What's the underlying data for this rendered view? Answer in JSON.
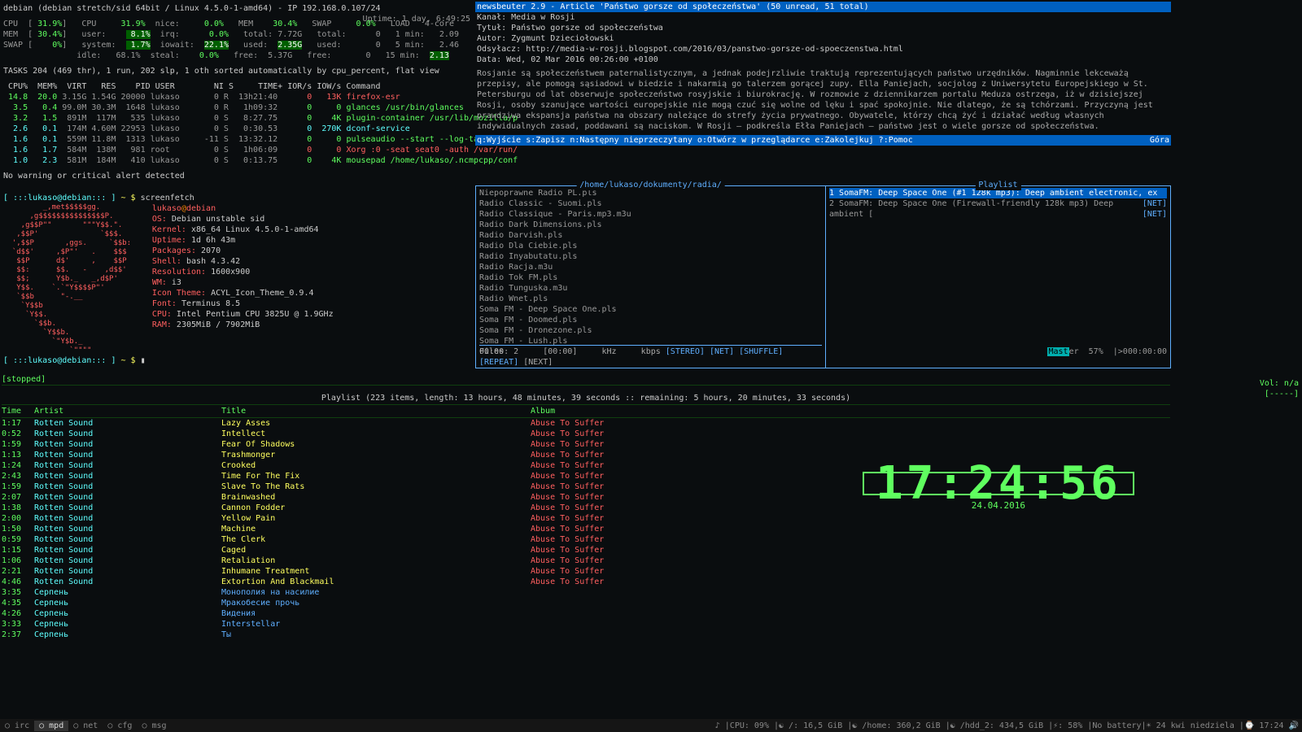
{
  "glances": {
    "host": "debian (debian stretch/sid 64bit / Linux 4.5.0-1-amd64) - IP 192.168.0.107/24",
    "uptime": "Uptime: 1 day, 6:49:25",
    "stats": [
      "CPU  [ 31.9%]   CPU     31.9%  nice:     0.0%   MEM    30.4%   SWAP     0.0%   LOAD   4-core",
      "MEM  [ 30.4%]   user:    8.1%  irq:      0.0%   total: 7.72G   total:      0   1 min:   2.09",
      "SWAP [    0%]   system:  1.7%  iowait:  22.1%   used:  2.35G   used:       0   5 min:   2.46",
      "               idle:   68.1%  steal:    0.0%   free:  5.37G   free:       0   15 min:  2.13"
    ],
    "tasks": "TASKS 204 (469 thr), 1 run, 202 slp, 1 oth sorted automatically by cpu_percent, flat view",
    "phead": " CPU%  MEM%  VIRT   RES    PID USER        NI S     TIME+ IOR/s IOW/s Command",
    "procs": [
      " 14.8  20.0 3.15G 1.54G 20000 lukaso       0 R  13h21:40      0   13K firefox-esr",
      "  3.5   0.4 99.0M 30.3M  1648 lukaso       0 R   1h09:32      0     0 glances /usr/bin/glances",
      "  3.2   1.5  891M  117M   535 lukaso       0 S   8:27.75      0    4K plugin-container /usr/lib/mozilla/p",
      "  2.6   0.1  174M 4.60M 22953 lukaso       0 S   0:30.53      0  270K dconf-service",
      "  1.6   0.1  559M 11.8M  1313 lukaso     -11 S  13:32.12      0     0 pulseaudio --start --log-target=sys",
      "  1.6   1.7  584M  138M   981 root         0 S   1h06:09      0     0 Xorg :0 -seat seat0 -auth /var/run/",
      "  1.0   2.3  581M  184M   410 lukaso       0 S   0:13.75      0    4K mousepad /home/lukaso/.ncmpcpp/conf"
    ],
    "warn": "No warning or critical alert detected"
  },
  "term": {
    "prompt": "[ :::lukaso@debian::: ] ~ $ screenfetch",
    "logo": [
      "         _,met$$$$$gg.           ",
      "      ,g$$$$$$$$$$$$$$$P.        ",
      "    ,g$$P\"\"       \"\"\"Y$$.\".      ",
      "   ,$$P'              `$$$.      ",
      "  ',$$P       ,ggs.     `$$b:    ",
      "  `d$$'     ,$P\"'   .    $$$     ",
      "   $$P      d$'     ,    $$P     ",
      "   $$:      $$.   -    ,d$$'     ",
      "   $$;      Y$b._   _,d$P'       ",
      "   Y$$.    `.`\"Y$$$$P\"'          ",
      "   `$$b      \"-.__               ",
      "    `Y$$b                        ",
      "     `Y$$.                       ",
      "       `$$b.                     ",
      "         `Y$$b.                  ",
      "           `\"Y$b._               ",
      "               `\"\"\"\"             "
    ],
    "info": [
      [
        "",
        "lukaso@debian"
      ],
      [
        "OS:",
        " Debian unstable sid"
      ],
      [
        "Kernel:",
        " x86_64 Linux 4.5.0-1-amd64"
      ],
      [
        "Uptime:",
        " 1d 6h 43m"
      ],
      [
        "Packages:",
        " 2070"
      ],
      [
        "Shell:",
        " bash 4.3.42"
      ],
      [
        "Resolution:",
        " 1600x900"
      ],
      [
        "WM:",
        " i3"
      ],
      [
        "Icon Theme:",
        " ACYL_Icon_Theme_0.9.4"
      ],
      [
        "Font:",
        " Terminus 8.5"
      ],
      [
        "CPU:",
        " Intel Pentium CPU 3825U @ 1.9GHz"
      ],
      [
        "RAM:",
        " 2305MiB / 7902MiB"
      ]
    ],
    "prompt2": "[ :::lukaso@debian::: ] ~ $ "
  },
  "news": {
    "title": "newsbeuter 2.9 - Article 'Państwo gorsze od społeczeństwa' (50 unread, 51 total)",
    "meta": [
      "Kanał: Media w Rosji",
      "Tytuł: Państwo gorsze od społeczeństwa",
      "Autor: Zygmunt Dzieciołowski",
      "Odsyłacz: http://media-w-rosji.blogspot.com/2016/03/panstwo-gorsze-od-spoeczenstwa.html",
      "Data: Wed, 02 Mar 2016 00:26:00 +0100"
    ],
    "body": "Rosjanie są społeczeństwem paternalistycznym, a jednak podejrzliwie traktują reprezentujących państwo urzędników. Nagminnie lekceważą przepisy, ale pomogą sąsiadowi w biedzie i nakarmią go talerzem gorącej zupy. Ella Paniejach, socjolog z Uniwersytetu Europejskiego w St. Petersburgu od lat obserwuje społeczeństwo rosyjskie i biurokrację. W rozmowie z dziennikarzem portalu Meduza ostrzega, iż w dzisiejszej Rosji, osoby szanujące wartości europejskie nie mogą czuć się wolne od lęku i spać spokojnie. Nie dlatego, że są tchórzami. Przyczyną jest prawdziwa ekspansja państwa na obszary należące do strefy życia prywatnego. Obywatele, którzy chcą żyć i działać według własnych indywidualnych zasad, poddawani są naciskom. W Rosji – podkreśla Ełła Paniejach – państwo jest o wiele gorsze od społeczeństwa.",
    "help": "q:Wyjście s:Zapisz n:Następny nieprzeczytany o:Otwórz w przeglądarce e:Zakolejkuj ?:Pomoc",
    "top": "Góra"
  },
  "moc": {
    "leftTitle": "/home/lukaso/dokumenty/radia/",
    "files": [
      "Niepoprawne Radio PL.pls",
      "Radio Classic - Suomi.pls",
      "Radio Classique - Paris.mp3.m3u",
      "Radio Dark Dimensions.pls",
      "Radio Darvish.pls",
      "Radio Dla Ciebie.pls",
      "Radio Inyabutatu.pls",
      "Radio Racja.m3u",
      "Radio Tok FM.pls",
      "Radio Tunguska.m3u",
      "Radio Wnet.pls",
      "Soma FM - Deep Space One.pls",
      "Soma FM - Doomed.pls",
      "Soma FM - Dronezone.pls",
      "Soma FM - Lush.pls"
    ],
    "filesCount": "Files: 2",
    "rightTitle": "Playlist",
    "pl": [
      {
        "n": "1",
        "t": "SomaFM: Deep Space One (#1 128k mp3): Deep ambient electronic, ex",
        "net": "[NET]",
        "sel": true
      },
      {
        "n": "2",
        "t": "SomaFM: Deep Space One (Firewall-friendly 128k mp3) Deep ambient [",
        "net": "[NET]",
        "sel": false
      }
    ],
    "master": "Master  57%  |>000:00:00",
    "time": "[]\n00:00        [00:00]     kHz     kbps [STEREO] [NET] [SHUFFLE] [REPEAT] [NEXT]\n["
  },
  "player": {
    "stopped": "[stopped]",
    "vol": "Vol: n/a\n[-----]",
    "title": "Playlist (223 items, length: 13 hours, 48 minutes, 39 seconds :: remaining: 5 hours, 20 minutes, 33 seconds)",
    "head": [
      "Time",
      "Artist",
      "Title",
      "Album"
    ],
    "rows": [
      [
        "1:17",
        "Rotten Sound",
        "Lazy Asses",
        "Abuse To Suffer",
        "a"
      ],
      [
        "0:52",
        "Rotten Sound",
        "Intellect",
        "Abuse To Suffer",
        "a"
      ],
      [
        "1:59",
        "Rotten Sound",
        "Fear Of Shadows",
        "Abuse To Suffer",
        "a"
      ],
      [
        "1:13",
        "Rotten Sound",
        "Trashmonger",
        "Abuse To Suffer",
        "a"
      ],
      [
        "1:24",
        "Rotten Sound",
        "Crooked",
        "Abuse To Suffer",
        "a"
      ],
      [
        "2:43",
        "Rotten Sound",
        "Time For The Fix",
        "Abuse To Suffer",
        "a"
      ],
      [
        "1:59",
        "Rotten Sound",
        "Slave To The Rats",
        "Abuse To Suffer",
        "a"
      ],
      [
        "2:07",
        "Rotten Sound",
        "Brainwashed",
        "Abuse To Suffer",
        "a"
      ],
      [
        "1:38",
        "Rotten Sound",
        "Cannon Fodder",
        "Abuse To Suffer",
        "a"
      ],
      [
        "2:00",
        "Rotten Sound",
        "Yellow Pain",
        "Abuse To Suffer",
        "a"
      ],
      [
        "1:50",
        "Rotten Sound",
        "Machine",
        "Abuse To Suffer",
        "a"
      ],
      [
        "0:59",
        "Rotten Sound",
        "The Clerk",
        "Abuse To Suffer",
        "a"
      ],
      [
        "1:15",
        "Rotten Sound",
        "Caged",
        "Abuse To Suffer",
        "a"
      ],
      [
        "1:06",
        "Rotten Sound",
        "Retaliation",
        "Abuse To Suffer",
        "a"
      ],
      [
        "2:21",
        "Rotten Sound",
        "Inhumane Treatment",
        "Abuse To Suffer",
        "a"
      ],
      [
        "4:46",
        "Rotten Sound",
        "Extortion And Blackmail",
        "Abuse To Suffer",
        "a"
      ],
      [
        "3:35",
        "Серпень",
        "Монополия на насилие",
        "<empty>",
        "b"
      ],
      [
        "4:35",
        "Серпень",
        "Мракобесие прочь",
        "<empty>",
        "b"
      ],
      [
        "4:26",
        "Серпень",
        "Видения",
        "<empty>",
        "b"
      ],
      [
        "3:33",
        "Серпень",
        "Interstellar",
        "<empty>",
        "b"
      ],
      [
        "2:37",
        "Серпень",
        "Ты",
        "<empty>",
        "b"
      ]
    ]
  },
  "clock": {
    "time": "17:24:56",
    "date": "24.04.2016"
  },
  "bar": {
    "ws": [
      "irc",
      "mpd",
      "net",
      "cfg",
      "msg"
    ],
    "active": 1,
    "right": "♪ |CPU: 09% |☯ /: 16,5 GiB |☯ /home: 360,2 GiB |☯ /hdd_2: 434,5 GiB |⚡: 58% |No battery|☀ 24 kwi niedziela |⌚ 17:24 🔊"
  }
}
